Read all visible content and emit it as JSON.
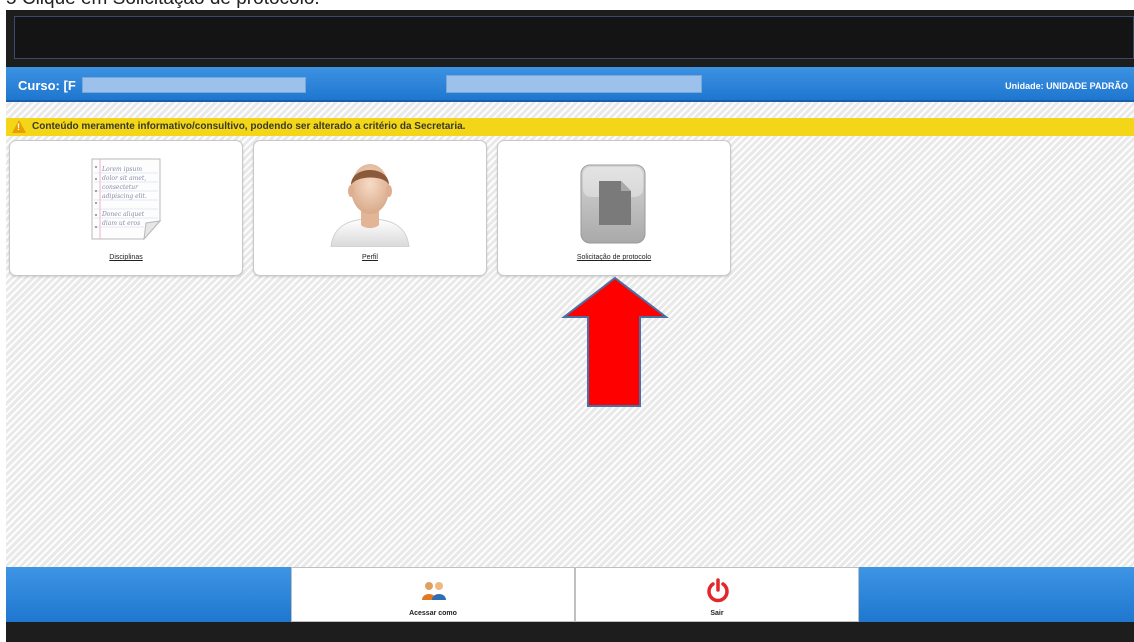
{
  "instruction": "5 Clique em Solicitação de protocolo.",
  "header": {
    "course_label": "Curso: [F",
    "unit_label": "Unidade: UNIDADE PADRÃO"
  },
  "warning": {
    "text": "Conteúdo meramente informativo/consultivo, podendo ser alterado a critério da Secretaria.",
    "icon_glyph": "!"
  },
  "tiles": [
    {
      "label": "Disciplinas",
      "icon": "notebook-icon"
    },
    {
      "label": "Perfil",
      "icon": "user-profile-icon"
    },
    {
      "label": "Solicitação de protocolo",
      "icon": "document-icon"
    }
  ],
  "notebook_lines": [
    "Lorem ipsum",
    "dolor sit amet,",
    "consectetur",
    "adipiscing elit.",
    "Donec aliquet",
    "diam ut eros"
  ],
  "footer": {
    "access_as_label": "Acessar como",
    "logout_label": "Sair"
  },
  "colors": {
    "header_blue": "#2a84d9",
    "warning_yellow": "#f2d617",
    "arrow_red": "#ff0000",
    "arrow_outline": "#4a6fa5",
    "power_red": "#e3262b"
  }
}
